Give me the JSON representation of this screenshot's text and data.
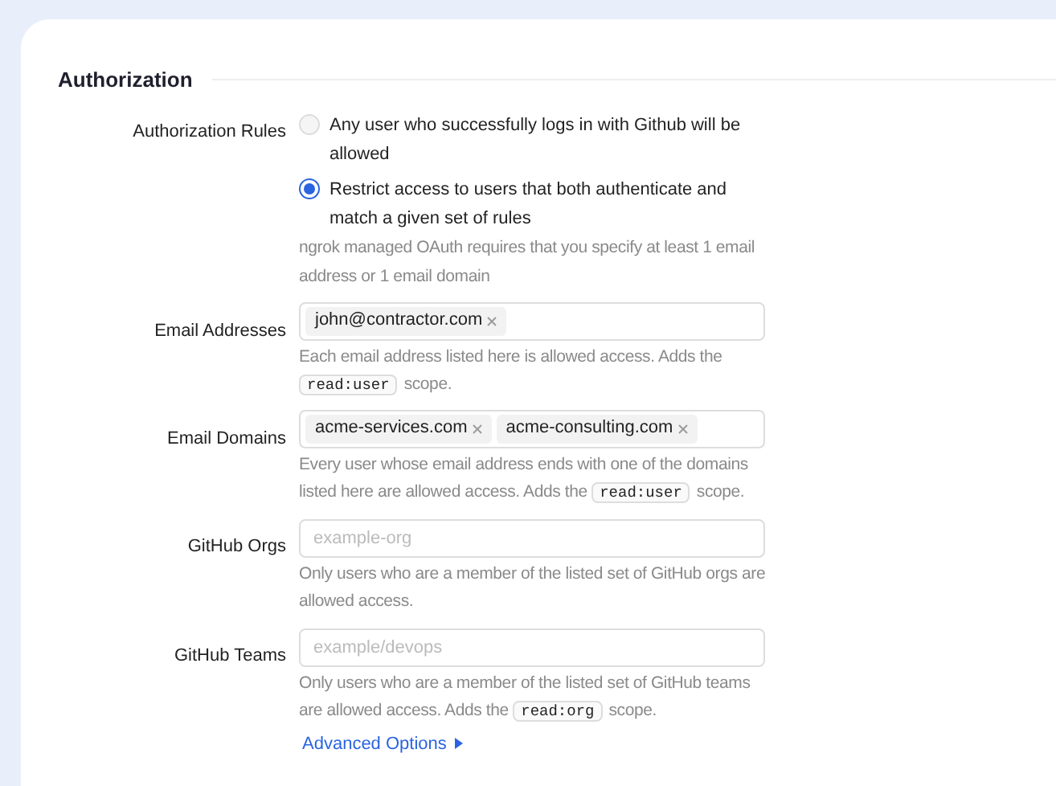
{
  "section": {
    "title": "Authorization"
  },
  "rules": {
    "label": "Authorization Rules",
    "options": [
      {
        "label": "Any user who successfully logs in with Github will be allowed",
        "selected": false
      },
      {
        "label": "Restrict access to users that both authenticate and match a given set of rules",
        "selected": true
      }
    ],
    "help": "ngrok managed OAuth requires that you specify at least 1 email address or 1 email domain"
  },
  "fields": [
    {
      "kind": "tags",
      "label": "Email Addresses",
      "tags": [
        "john@contractor.com"
      ],
      "help": [
        {
          "kind": "text",
          "text": "Each email address listed here is allowed access. Adds the"
        },
        {
          "kind": "code",
          "text": "read:user"
        },
        {
          "kind": "text",
          "text": "scope."
        }
      ]
    },
    {
      "kind": "tags",
      "label": "Email Domains",
      "tags": [
        "acme-services.com",
        "acme-consulting.com"
      ],
      "help": [
        {
          "kind": "text",
          "text": "Every user whose email address ends with one of the domains listed here are allowed access. Adds the"
        },
        {
          "kind": "code",
          "text": "read:user"
        },
        {
          "kind": "text",
          "text": "scope."
        }
      ]
    },
    {
      "kind": "text",
      "label": "GitHub Orgs",
      "placeholder": "example-org",
      "help": [
        {
          "kind": "text",
          "text": "Only users who are a member of the listed set of GitHub orgs are allowed access."
        }
      ]
    },
    {
      "kind": "text",
      "label": "GitHub Teams",
      "placeholder": "example/devops",
      "help": [
        {
          "kind": "text",
          "text": "Only users who are a member of the listed set of GitHub teams are allowed access. Adds the"
        },
        {
          "kind": "code",
          "text": "read:org"
        },
        {
          "kind": "text",
          "text": "scope."
        }
      ]
    }
  ],
  "advanced": {
    "label": "Advanced Options"
  }
}
